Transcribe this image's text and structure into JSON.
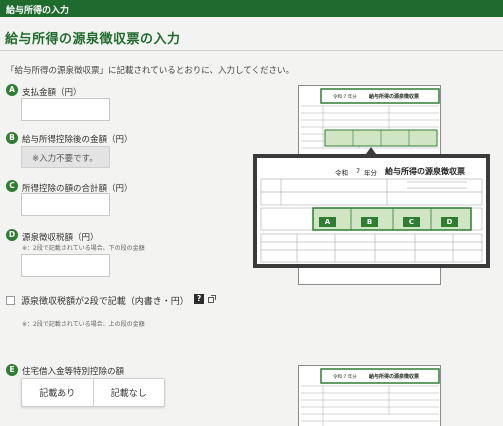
{
  "header": {
    "breadcrumb": "給与所得の入力"
  },
  "page": {
    "title": "給与所得の源泉徴収票の入力",
    "intro": "「給与所得の源泉徴収票」に記載されているとおりに、入力してください。"
  },
  "fields": {
    "a": {
      "badge": "A",
      "label": "支払金額（円）",
      "value": ""
    },
    "b": {
      "badge": "B",
      "label": "給与所得控除後の金額（円）",
      "disabled_text": "※入力不要です。"
    },
    "c": {
      "badge": "C",
      "label": "所得控除の額の合計額（円）",
      "value": ""
    },
    "d": {
      "badge": "D",
      "label": "源泉徴収税額（円）",
      "note": "※：2段で記載されている場合、下の段の金額",
      "value": ""
    }
  },
  "two_row_option": {
    "label": "源泉徴収税額が2段で記載（内書き・円）",
    "note": "※：2段で記載されている場合、上の段の金額",
    "help_icon": "?",
    "checked": false
  },
  "housing_loan": {
    "badge": "E",
    "label": "住宅借入金等特別控除の額",
    "options": [
      "記載あり",
      "記載なし"
    ]
  },
  "form_image": {
    "year_prefix": "令和",
    "year": "7",
    "year_suffix": "年分",
    "title": "給与所得の源泉徴収票",
    "markers": [
      "A",
      "B",
      "C",
      "D"
    ]
  },
  "colors": {
    "brand": "#1f6b2e",
    "badge": "#2e7d32",
    "highlight": "#cfe5c4"
  }
}
